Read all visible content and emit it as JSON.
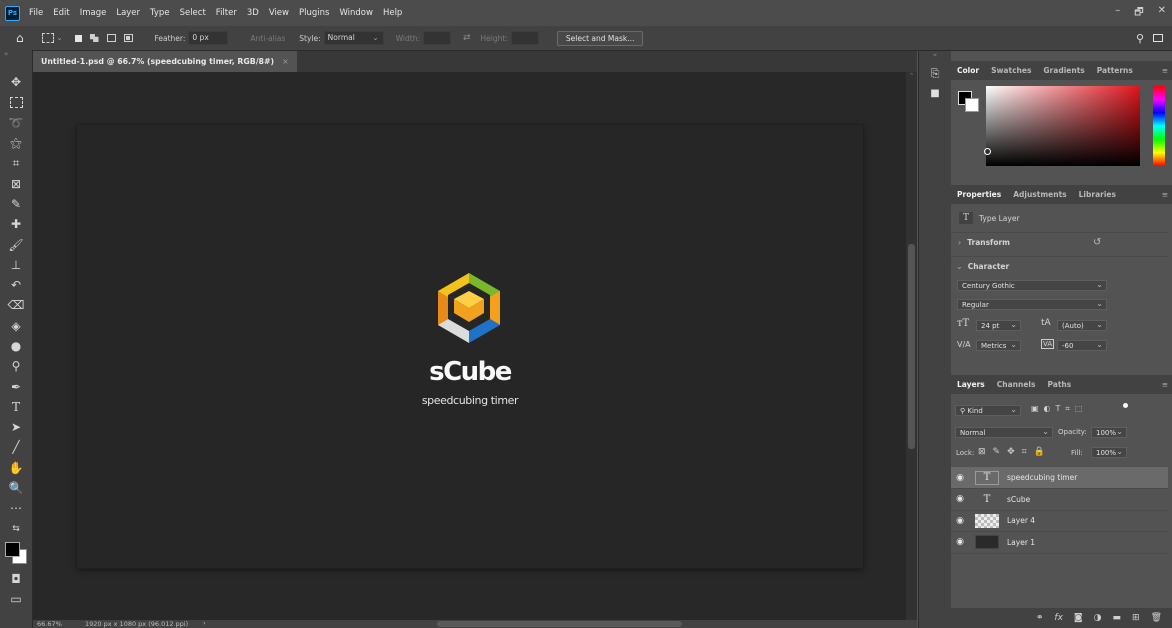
{
  "app": {
    "logo": "Ps"
  },
  "menu": [
    "File",
    "Edit",
    "Image",
    "Layer",
    "Type",
    "Select",
    "Filter",
    "3D",
    "View",
    "Plugins",
    "Window",
    "Help"
  ],
  "window_controls": {
    "minimize": "–",
    "restore": "🗗",
    "close": "✕"
  },
  "options": {
    "feather_label": "Feather:",
    "feather_value": "0 px",
    "antialias_label": "Anti-alias",
    "style_label": "Style:",
    "style_value": "Normal",
    "width_label": "Width:",
    "height_label": "Height:",
    "select_mask": "Select and Mask..."
  },
  "document": {
    "tab_title": "Untitled-1.psd @ 66.7% (speedcubing timer, RGB/8#)",
    "tab_close": "×",
    "logo_title": "sCube",
    "logo_subtitle": "speedcubing timer"
  },
  "status": {
    "zoom": "66.67%",
    "info": "1920 px x 1080 px (96.012 ppi)",
    "arrow": "›"
  },
  "color_panel": {
    "tabs": [
      "Color",
      "Swatches",
      "Gradients",
      "Patterns"
    ]
  },
  "properties_panel": {
    "tabs": [
      "Properties",
      "Adjustments",
      "Libraries"
    ],
    "layer_type": "Type Layer",
    "transform": "Transform",
    "character": "Character",
    "font_family": "Century Gothic",
    "font_style": "Regular",
    "font_size": "24 pt",
    "leading": "(Auto)",
    "kerning": "Metrics",
    "tracking": "-60"
  },
  "layers_panel": {
    "tabs": [
      "Layers",
      "Channels",
      "Paths"
    ],
    "filter_kind": "Kind",
    "blend_mode": "Normal",
    "opacity_label": "Opacity:",
    "opacity_value": "100%",
    "lock_label": "Lock:",
    "fill_label": "Fill:",
    "fill_value": "100%",
    "layers": [
      {
        "name": "speedcubing timer",
        "type": "text",
        "selected": true
      },
      {
        "name": "sCube",
        "type": "text-plain",
        "selected": false
      },
      {
        "name": "Layer 4",
        "type": "checker",
        "selected": false
      },
      {
        "name": "Layer 1",
        "type": "dark",
        "selected": false
      }
    ]
  },
  "colors": {
    "accent_bg": "#282828",
    "logo_orange": "#e98a16",
    "logo_green": "#78b829",
    "logo_blue": "#1e73c8"
  }
}
